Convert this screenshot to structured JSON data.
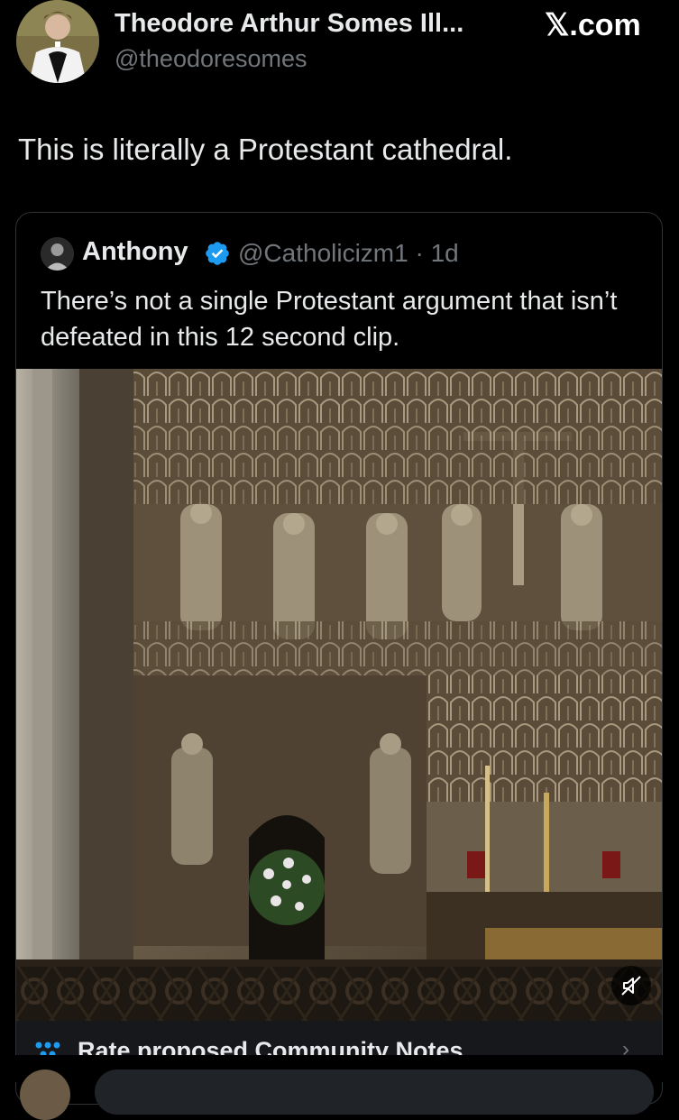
{
  "header": {
    "author_name": "Theodore Arthur Somes Ill...",
    "author_handle": "@theodoresomes",
    "site_label": "𝕏.com"
  },
  "tweet": {
    "text": "This is literally a Protestant cathedral."
  },
  "quoted": {
    "name": "Anthony",
    "handle_time": "@Catholicizm1 · 1d",
    "text": "There’s not a single Protestant argument that isn’t defeated in this 12 second clip."
  },
  "community_notes": {
    "label": "Rate proposed Community Notes"
  },
  "colors": {
    "background": "#000000",
    "text": "#e7e9ea",
    "muted": "#71767b",
    "verified": "#1d9bf0",
    "border": "#2f3336"
  },
  "icons": [
    "verified-badge-icon",
    "mute-icon",
    "community-notes-icon",
    "chevron-right-icon"
  ]
}
